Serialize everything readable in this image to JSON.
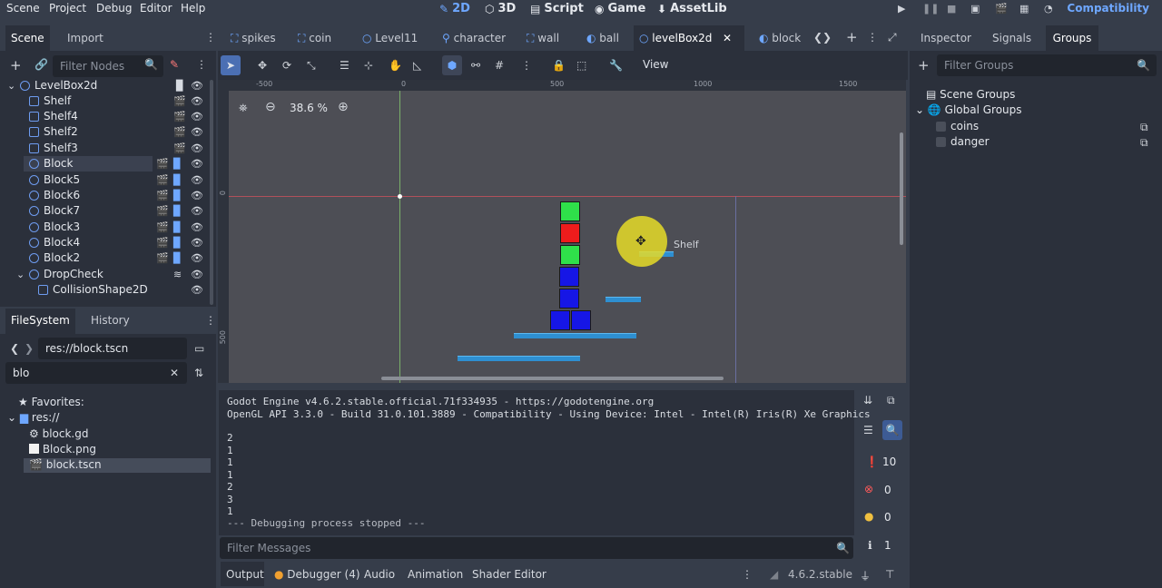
{
  "menu": [
    "Scene",
    "Project",
    "Debug",
    "Editor",
    "Help"
  ],
  "workspaces": [
    {
      "label": "2D",
      "icon": "2d-icon",
      "active": true
    },
    {
      "label": "3D",
      "icon": "3d-icon"
    },
    {
      "label": "Script",
      "icon": "script-icon"
    },
    {
      "label": "Game",
      "icon": "game-icon"
    },
    {
      "label": "AssetLib",
      "icon": "assetlib-icon"
    }
  ],
  "renderer": "Compatibility",
  "left_tabs": {
    "scene": "Scene",
    "import": "Import"
  },
  "scene_filter_placeholder": "Filter Nodes",
  "scene_tree": [
    {
      "label": "LevelBox2d",
      "icon": "node2d-icon",
      "selected": false
    },
    {
      "label": "Shelf"
    },
    {
      "label": "Shelf4"
    },
    {
      "label": "Shelf2"
    },
    {
      "label": "Shelf3"
    },
    {
      "label": "Block",
      "selected": true
    },
    {
      "label": "Block5"
    },
    {
      "label": "Block6"
    },
    {
      "label": "Block7"
    },
    {
      "label": "Block3"
    },
    {
      "label": "Block4"
    },
    {
      "label": "Block2"
    },
    {
      "label": "DropCheck"
    },
    {
      "label": "CollisionShape2D"
    }
  ],
  "filesystem": {
    "tab": "FileSystem",
    "history_tab": "History",
    "path": "res://block.tscn",
    "search": "blo",
    "favorites": "Favorites:",
    "root": "res://",
    "files": [
      "block.gd",
      "Block.png",
      "block.tscn"
    ]
  },
  "editor_tabs": [
    "spikes",
    "coin",
    "Level11",
    "character",
    "wall",
    "ball",
    "levelBox2d",
    "block"
  ],
  "active_editor_tab": "levelBox2d",
  "toolbar": {
    "view": "View"
  },
  "viewport": {
    "zoom": "38.6 %",
    "ruler_h": [
      "-500",
      "0",
      "500",
      "1000",
      "1500"
    ],
    "ruler_v": [
      "0",
      "500"
    ],
    "shelf_label": "Shelf"
  },
  "right_tabs": {
    "inspector": "Inspector",
    "signals": "Signals",
    "groups": "Groups"
  },
  "groups": {
    "filter_placeholder": "Filter Groups",
    "scene_groups": "Scene Groups",
    "global_groups": "Global Groups",
    "items": [
      "coins",
      "danger"
    ]
  },
  "console": {
    "lines": [
      "Godot Engine v4.6.2.stable.official.71f334935 - https://godotengine.org",
      "OpenGL API 3.3.0 - Build 31.0.101.3889 - Compatibility - Using Device: Intel - Intel(R) Iris(R) Xe Graphics",
      "",
      "2",
      "1",
      "1",
      "1",
      "2",
      "3",
      "1",
      "--- Debugging process stopped ---"
    ],
    "filter_placeholder": "Filter Messages",
    "counts": {
      "messages": "10",
      "errors": "0",
      "warnings": "0",
      "info": "1"
    }
  },
  "bottom_tabs": [
    "Output",
    "Debugger (4)",
    "Audio",
    "Animation",
    "Shader Editor"
  ],
  "version": "4.6.2.stable"
}
